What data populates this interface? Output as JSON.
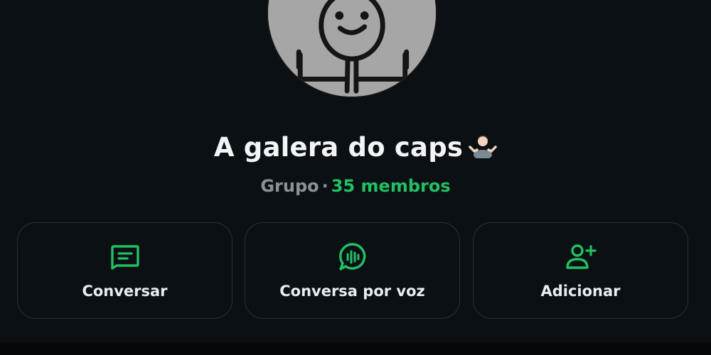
{
  "group": {
    "name": "A galera do caps",
    "name_emoji": "person-shrugging-emoji",
    "kind": "Grupo",
    "separator": "·",
    "members": "35 membros"
  },
  "actions": [
    {
      "label": "Conversar",
      "icon": "message-icon"
    },
    {
      "label": "Conversa por voz",
      "icon": "voice-chat-icon"
    },
    {
      "label": "Adicionar",
      "icon": "add-person-icon"
    }
  ],
  "colors": {
    "background": "#0b1014",
    "accent": "#21c063",
    "text": "#f2f4f5",
    "muted": "#8b9196",
    "card_border": "#2a3035"
  }
}
